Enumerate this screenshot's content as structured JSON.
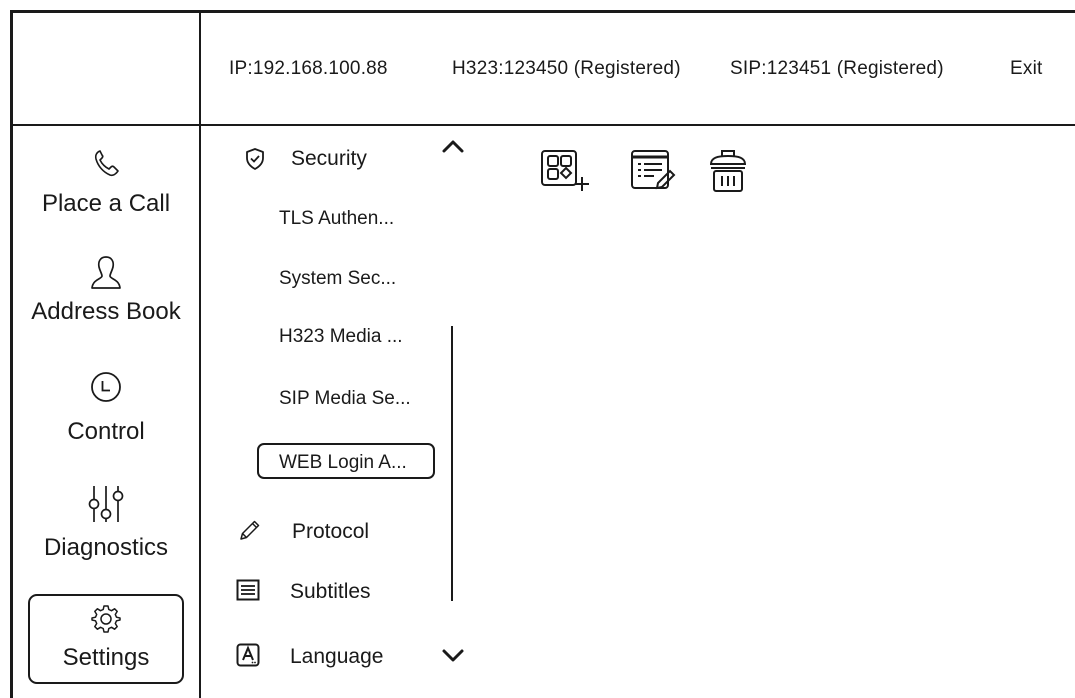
{
  "header": {
    "ip": "IP:192.168.100.88",
    "h323": "H323:123450 (Registered)",
    "sip": "SIP:123451 (Registered)",
    "exit_label": "Exit"
  },
  "nav": {
    "items": [
      {
        "label": "Place a Call",
        "icon": "phone-icon"
      },
      {
        "label": "Address Book",
        "icon": "person-icon"
      },
      {
        "label": "Control",
        "icon": "clock-icon"
      },
      {
        "label": "Diagnostics",
        "icon": "sliders-icon"
      },
      {
        "label": "Settings",
        "icon": "gear-icon",
        "selected": true
      }
    ]
  },
  "tree": {
    "security": {
      "label": "Security",
      "icon": "shield-check-icon",
      "expanded": true,
      "children": [
        {
          "label": "TLS Authen..."
        },
        {
          "label": "System Sec..."
        },
        {
          "label": "H323 Media ..."
        },
        {
          "label": "SIP Media Se..."
        },
        {
          "label": "WEB Login A...",
          "selected": true
        }
      ]
    },
    "protocol": {
      "label": "Protocol",
      "icon": "pencil-icon"
    },
    "subtitles": {
      "label": "Subtitles",
      "icon": "text-lines-icon"
    },
    "language": {
      "label": "Language",
      "icon": "language-icon"
    }
  },
  "toolbar": {
    "icons": [
      "add-grid-icon",
      "edit-list-icon",
      "trash-icon"
    ]
  },
  "colors": {
    "stroke": "#1a1a1a",
    "background": "#ffffff"
  }
}
